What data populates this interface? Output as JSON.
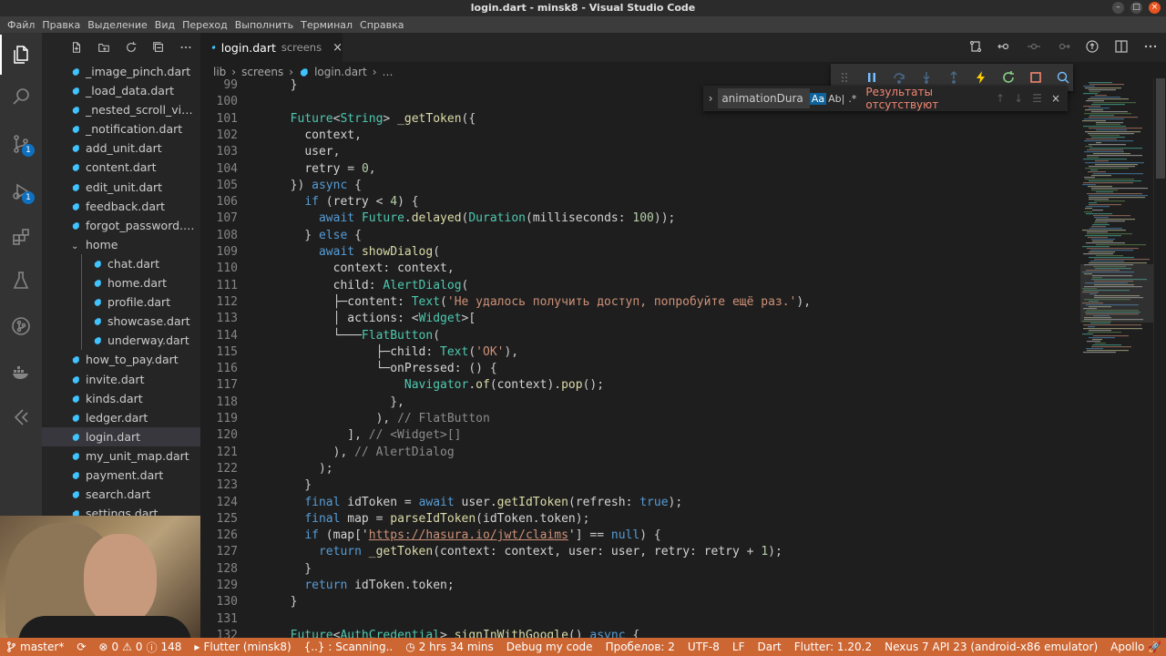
{
  "window": {
    "title": "login.dart - minsk8 - Visual Studio Code"
  },
  "menu": [
    "Файл",
    "Правка",
    "Выделение",
    "Вид",
    "Переход",
    "Выполнить",
    "Терминал",
    "Справка"
  ],
  "activity": {
    "scm_badge": "1",
    "debug_badge": "1"
  },
  "explorer": {
    "files": [
      {
        "name": "_image_pinch.dart",
        "indent": 1
      },
      {
        "name": "_load_data.dart",
        "indent": 1
      },
      {
        "name": "_nested_scroll_vie...",
        "indent": 1
      },
      {
        "name": "_notification.dart",
        "indent": 1
      },
      {
        "name": "add_unit.dart",
        "indent": 1
      },
      {
        "name": "content.dart",
        "indent": 1
      },
      {
        "name": "edit_unit.dart",
        "indent": 1
      },
      {
        "name": "feedback.dart",
        "indent": 1
      },
      {
        "name": "forgot_password.dart",
        "indent": 1
      },
      {
        "name": "home",
        "indent": 1,
        "folder": true
      },
      {
        "name": "chat.dart",
        "indent": 2
      },
      {
        "name": "home.dart",
        "indent": 2
      },
      {
        "name": "profile.dart",
        "indent": 2
      },
      {
        "name": "showcase.dart",
        "indent": 2
      },
      {
        "name": "underway.dart",
        "indent": 2
      },
      {
        "name": "how_to_pay.dart",
        "indent": 1
      },
      {
        "name": "invite.dart",
        "indent": 1
      },
      {
        "name": "kinds.dart",
        "indent": 1
      },
      {
        "name": "ledger.dart",
        "indent": 1
      },
      {
        "name": "login.dart",
        "indent": 1,
        "selected": true
      },
      {
        "name": "my_unit_map.dart",
        "indent": 1
      },
      {
        "name": "payment.dart",
        "indent": 1
      },
      {
        "name": "search.dart",
        "indent": 1
      },
      {
        "name": "settings.dart",
        "indent": 1
      }
    ]
  },
  "tab": {
    "name": "login.dart",
    "description": "screens",
    "close": "×"
  },
  "breadcrumb": [
    "lib",
    "screens",
    "login.dart",
    "…"
  ],
  "find": {
    "value": "animationDura",
    "match_case": "Aa",
    "whole_word": "Ab|",
    "regex": ".*",
    "no_results": "Результаты отсутствуют"
  },
  "code": [
    {
      "n": "99",
      "t": [
        [
          "pl",
          "  }"
        ]
      ]
    },
    {
      "n": "100",
      "t": []
    },
    {
      "n": "101",
      "t": [
        [
          "pl",
          "  "
        ],
        [
          "ty",
          "Future"
        ],
        [
          "pl",
          "<"
        ],
        [
          "ty",
          "String"
        ],
        [
          "pl",
          "> "
        ],
        [
          "fn",
          "_getToken"
        ],
        [
          "pl",
          "({"
        ]
      ]
    },
    {
      "n": "102",
      "t": [
        [
          "pl",
          "    "
        ],
        [
          "id",
          "context"
        ],
        [
          "pl",
          ","
        ]
      ]
    },
    {
      "n": "103",
      "t": [
        [
          "pl",
          "    "
        ],
        [
          "id",
          "user"
        ],
        [
          "pl",
          ","
        ]
      ]
    },
    {
      "n": "104",
      "t": [
        [
          "pl",
          "    "
        ],
        [
          "id",
          "retry"
        ],
        [
          "pl",
          " = "
        ],
        [
          "nm",
          "0"
        ],
        [
          "pl",
          ","
        ]
      ]
    },
    {
      "n": "105",
      "t": [
        [
          "pl",
          "  }) "
        ],
        [
          "k",
          "async"
        ],
        [
          "pl",
          " {"
        ]
      ]
    },
    {
      "n": "106",
      "t": [
        [
          "pl",
          "    "
        ],
        [
          "k",
          "if"
        ],
        [
          "pl",
          " ("
        ],
        [
          "id",
          "retry"
        ],
        [
          "pl",
          " < "
        ],
        [
          "nm",
          "4"
        ],
        [
          "pl",
          ") {"
        ]
      ]
    },
    {
      "n": "107",
      "t": [
        [
          "pl",
          "      "
        ],
        [
          "k",
          "await"
        ],
        [
          "pl",
          " "
        ],
        [
          "ty",
          "Future"
        ],
        [
          "pl",
          "."
        ],
        [
          "fn",
          "delayed"
        ],
        [
          "pl",
          "("
        ],
        [
          "ty",
          "Duration"
        ],
        [
          "pl",
          "("
        ],
        [
          "id",
          "milliseconds"
        ],
        [
          "pl",
          ": "
        ],
        [
          "nm",
          "100"
        ],
        [
          "pl",
          "));"
        ]
      ]
    },
    {
      "n": "108",
      "t": [
        [
          "pl",
          "    } "
        ],
        [
          "k",
          "else"
        ],
        [
          "pl",
          " {"
        ]
      ]
    },
    {
      "n": "109",
      "t": [
        [
          "pl",
          "      "
        ],
        [
          "k",
          "await"
        ],
        [
          "pl",
          " "
        ],
        [
          "fn",
          "showDialog"
        ],
        [
          "pl",
          "("
        ]
      ]
    },
    {
      "n": "110",
      "t": [
        [
          "pl",
          "        "
        ],
        [
          "id",
          "context"
        ],
        [
          "pl",
          ": "
        ],
        [
          "id",
          "context"
        ],
        [
          "pl",
          ","
        ]
      ]
    },
    {
      "n": "111",
      "t": [
        [
          "pl",
          "        "
        ],
        [
          "id",
          "child"
        ],
        [
          "pl",
          ": "
        ],
        [
          "ty",
          "AlertDialog"
        ],
        [
          "pl",
          "("
        ]
      ]
    },
    {
      "n": "112",
      "t": [
        [
          "pl",
          "        ├─"
        ],
        [
          "id",
          "content"
        ],
        [
          "pl",
          ": "
        ],
        [
          "ty",
          "Text"
        ],
        [
          "pl",
          "("
        ],
        [
          "st",
          "'Не удалось получить доступ, попробуйте ещё раз.'"
        ],
        [
          "pl",
          "),"
        ]
      ]
    },
    {
      "n": "113",
      "t": [
        [
          "pl",
          "        │ "
        ],
        [
          "id",
          "actions"
        ],
        [
          "pl",
          ": <"
        ],
        [
          "ty",
          "Widget"
        ],
        [
          "pl",
          ">["
        ]
      ]
    },
    {
      "n": "114",
      "t": [
        [
          "pl",
          "        └───"
        ],
        [
          "ty",
          "FlatButton"
        ],
        [
          "pl",
          "("
        ]
      ]
    },
    {
      "n": "115",
      "t": [
        [
          "pl",
          "              ├─"
        ],
        [
          "id",
          "child"
        ],
        [
          "pl",
          ": "
        ],
        [
          "ty",
          "Text"
        ],
        [
          "pl",
          "("
        ],
        [
          "st",
          "'OK'"
        ],
        [
          "pl",
          "),"
        ]
      ]
    },
    {
      "n": "116",
      "t": [
        [
          "pl",
          "              └─"
        ],
        [
          "id",
          "onPressed"
        ],
        [
          "pl",
          ": () {"
        ]
      ]
    },
    {
      "n": "117",
      "t": [
        [
          "pl",
          "                  "
        ],
        [
          "ty",
          "Navigator"
        ],
        [
          "pl",
          "."
        ],
        [
          "fn",
          "of"
        ],
        [
          "pl",
          "("
        ],
        [
          "id",
          "context"
        ],
        [
          "pl",
          ")."
        ],
        [
          "fn",
          "pop"
        ],
        [
          "pl",
          "();"
        ]
      ]
    },
    {
      "n": "118",
      "t": [
        [
          "pl",
          "                },"
        ]
      ]
    },
    {
      "n": "119",
      "t": [
        [
          "pl",
          "              ), "
        ],
        [
          "cm",
          "// FlatButton"
        ]
      ]
    },
    {
      "n": "120",
      "t": [
        [
          "pl",
          "          ], "
        ],
        [
          "cm",
          "// <Widget>[]"
        ]
      ]
    },
    {
      "n": "121",
      "t": [
        [
          "pl",
          "        ), "
        ],
        [
          "cm",
          "// AlertDialog"
        ]
      ]
    },
    {
      "n": "122",
      "t": [
        [
          "pl",
          "      );"
        ]
      ]
    },
    {
      "n": "123",
      "t": [
        [
          "pl",
          "    }"
        ]
      ]
    },
    {
      "n": "124",
      "t": [
        [
          "pl",
          "    "
        ],
        [
          "k",
          "final"
        ],
        [
          "pl",
          " "
        ],
        [
          "id",
          "idToken"
        ],
        [
          "pl",
          " = "
        ],
        [
          "k",
          "await"
        ],
        [
          "pl",
          " "
        ],
        [
          "id",
          "user"
        ],
        [
          "pl",
          "."
        ],
        [
          "fn",
          "getIdToken"
        ],
        [
          "pl",
          "("
        ],
        [
          "id",
          "refresh"
        ],
        [
          "pl",
          ": "
        ],
        [
          "k",
          "true"
        ],
        [
          "pl",
          ");"
        ]
      ]
    },
    {
      "n": "125",
      "t": [
        [
          "pl",
          "    "
        ],
        [
          "k",
          "final"
        ],
        [
          "pl",
          " "
        ],
        [
          "id",
          "map"
        ],
        [
          "pl",
          " = "
        ],
        [
          "fn",
          "parseIdToken"
        ],
        [
          "pl",
          "("
        ],
        [
          "id",
          "idToken"
        ],
        [
          "pl",
          "."
        ],
        [
          "id",
          "token"
        ],
        [
          "pl",
          ");"
        ]
      ]
    },
    {
      "n": "126",
      "t": [
        [
          "pl",
          "    "
        ],
        [
          "k",
          "if"
        ],
        [
          "pl",
          " ("
        ],
        [
          "id",
          "map"
        ],
        [
          "pl",
          "['"
        ],
        [
          "st ul",
          "https://hasura.io/jwt/claims"
        ],
        [
          "pl",
          "'] == "
        ],
        [
          "k",
          "null"
        ],
        [
          "pl",
          ") {"
        ]
      ]
    },
    {
      "n": "127",
      "t": [
        [
          "pl",
          "      "
        ],
        [
          "k",
          "return"
        ],
        [
          "pl",
          " "
        ],
        [
          "fn",
          "_getToken"
        ],
        [
          "pl",
          "("
        ],
        [
          "id",
          "context"
        ],
        [
          "pl",
          ": "
        ],
        [
          "id",
          "context"
        ],
        [
          "pl",
          ", "
        ],
        [
          "id",
          "user"
        ],
        [
          "pl",
          ": "
        ],
        [
          "id",
          "user"
        ],
        [
          "pl",
          ", "
        ],
        [
          "id",
          "retry"
        ],
        [
          "pl",
          ": "
        ],
        [
          "id",
          "retry"
        ],
        [
          "pl",
          " + "
        ],
        [
          "nm",
          "1"
        ],
        [
          "pl",
          ");"
        ]
      ]
    },
    {
      "n": "128",
      "t": [
        [
          "pl",
          "    }"
        ]
      ]
    },
    {
      "n": "129",
      "t": [
        [
          "pl",
          "    "
        ],
        [
          "k",
          "return"
        ],
        [
          "pl",
          " "
        ],
        [
          "id",
          "idToken"
        ],
        [
          "pl",
          "."
        ],
        [
          "id",
          "token"
        ],
        [
          "pl",
          ";"
        ]
      ]
    },
    {
      "n": "130",
      "t": [
        [
          "pl",
          "  }"
        ]
      ]
    },
    {
      "n": "131",
      "t": []
    },
    {
      "n": "132",
      "t": [
        [
          "pl",
          "  "
        ],
        [
          "ty",
          "Future"
        ],
        [
          "pl",
          "<"
        ],
        [
          "ty",
          "AuthCredential"
        ],
        [
          "pl",
          "> "
        ],
        [
          "fn",
          "signInWithGoogle"
        ],
        [
          "pl",
          "() "
        ],
        [
          "k",
          "async"
        ],
        [
          "pl",
          " {"
        ]
      ]
    }
  ],
  "status": {
    "branch": "master*",
    "errors": "0",
    "warnings": "0",
    "infos": "148",
    "flutter_project": "Flutter (minsk8)",
    "scanning": "{..} : Scanning..",
    "time": "2 hrs 34 mins",
    "debug": "Debug my code",
    "spaces": "Пробелов: 2",
    "encoding": "UTF-8",
    "eol": "LF",
    "language": "Dart",
    "flutter_version": "Flutter: 1.20.2",
    "device": "Nexus 7 API 23 (android-x86 emulator)",
    "apollo": "Apollo"
  },
  "colors": {
    "status_bar": "#cc6633",
    "badge": "#0e70c0",
    "debug_pause": "#75beff",
    "debug_restart": "#89d185",
    "debug_stop": "#f48771",
    "hot_reload": "#ffcc00"
  }
}
